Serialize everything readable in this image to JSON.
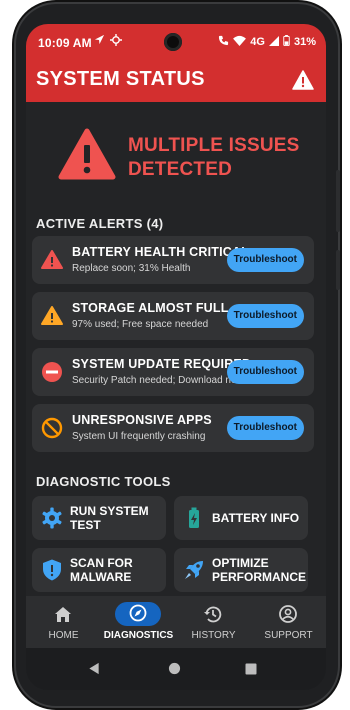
{
  "status_bar": {
    "time": "10:09 AM",
    "network": "4G",
    "battery": "31%"
  },
  "app_bar": {
    "title": "SYSTEM STATUS"
  },
  "hero": {
    "line1": "MULTIPLE ISSUES",
    "line2": "DETECTED"
  },
  "alerts_section": {
    "title": "ACTIVE ALERTS (4)"
  },
  "alerts": [
    {
      "title": "BATTERY HEALTH CRITICAL",
      "subtitle": "Replace soon; 31% Health",
      "button": "Troubleshoot",
      "icon": "warning-red-icon"
    },
    {
      "title": "STORAGE ALMOST FULL",
      "subtitle": "97% used; Free space needed",
      "button": "Troubleshoot",
      "icon": "warning-orange-icon"
    },
    {
      "title": "SYSTEM UPDATE REQUIRED",
      "subtitle": "Security Patch needed; Download now",
      "button": "Troubleshoot",
      "icon": "no-entry-icon"
    },
    {
      "title": "UNRESPONSIVE APPS",
      "subtitle": "System UI frequently crashing",
      "button": "Troubleshoot",
      "icon": "prohibited-icon"
    }
  ],
  "tools_section": {
    "title": "DIAGNOSTIC TOOLS"
  },
  "tools": [
    {
      "label1": "RUN SYSTEM",
      "label2": "TEST",
      "icon": "gear-icon"
    },
    {
      "label1": "BATTERY INFO",
      "label2": "",
      "icon": "battery-charging-icon"
    },
    {
      "label1": "SCAN FOR",
      "label2": "MALWARE",
      "icon": "shield-alert-icon"
    },
    {
      "label1": "OPTIMIZE",
      "label2": "PERFORMANCE",
      "icon": "rocket-icon"
    }
  ],
  "bottom_nav": [
    {
      "label": "HOME",
      "icon": "home-icon"
    },
    {
      "label": "DIAGNOSTICS",
      "icon": "compass-icon",
      "active": true
    },
    {
      "label": "HISTORY",
      "icon": "history-icon"
    },
    {
      "label": "SUPPORT",
      "icon": "support-icon"
    }
  ],
  "colors": {
    "brand_red": "#d32f2f",
    "alert_text": "#ef5350",
    "button_blue": "#42a5f5",
    "orange": "#ff9800",
    "teal": "#26a69a",
    "background": "#232426"
  }
}
